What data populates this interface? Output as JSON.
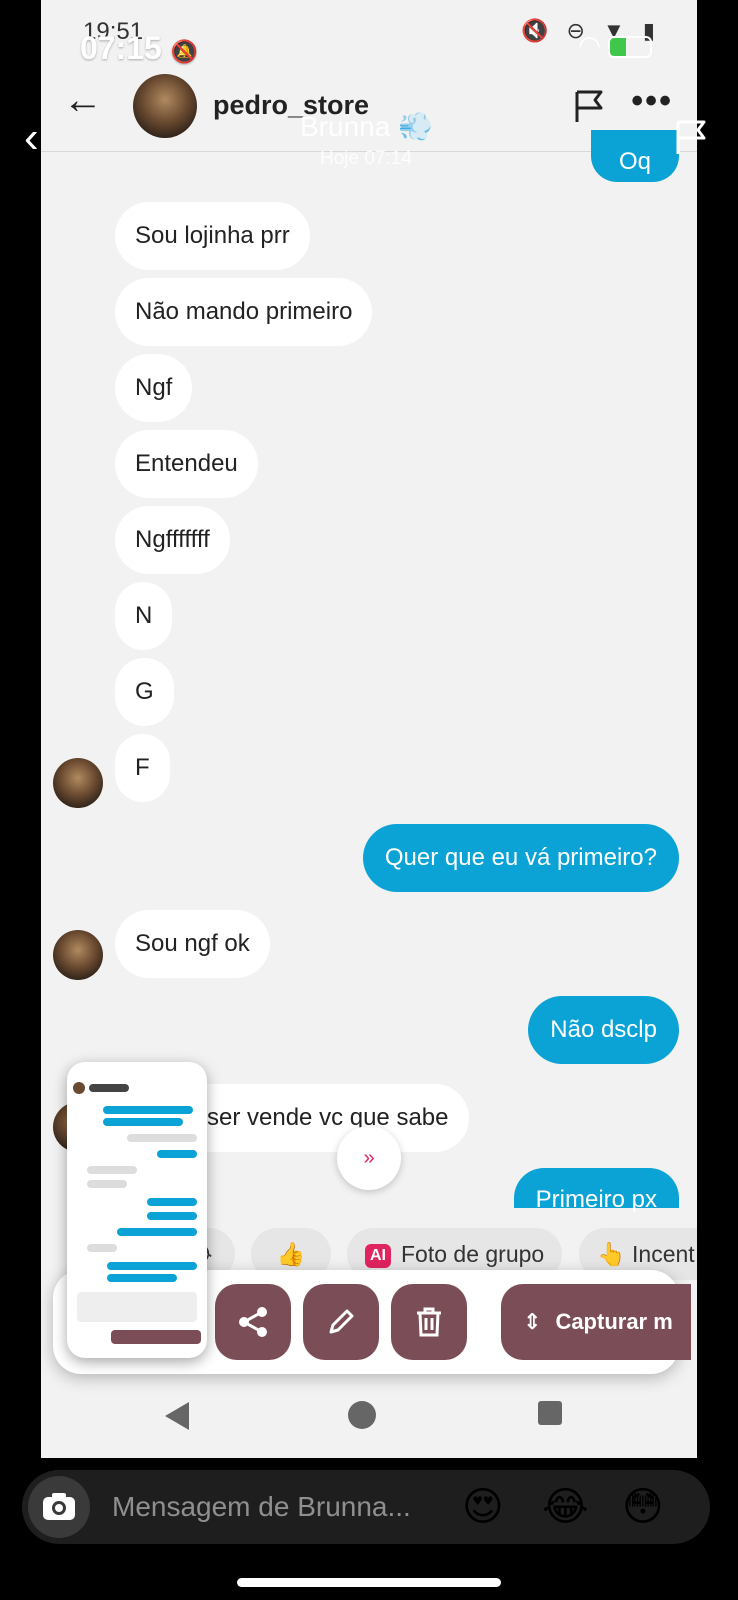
{
  "inner_status": {
    "time": "19:51",
    "icons": "🔇 ⊖ ▼ ▮"
  },
  "chat_header": {
    "username": "pedro_store"
  },
  "messages_in": [
    "Sou lojinha prr",
    "Não mando primeiro",
    "Ngf",
    "Entendeu",
    "Ngfffffff",
    "N",
    "G",
    "F",
    "Sou ngf ok",
    "ser vende vc que sabe"
  ],
  "messages_out": [
    "Oq",
    "Quer que eu vá primeiro?",
    "Não dsclp",
    "Primeiro px"
  ],
  "scroll_down_icon": "»",
  "chips": [
    "😂",
    "👍",
    "Foto de grupo",
    "Incent"
  ],
  "chip_ai_badge": "AI",
  "chip_incent_emoji": "👆",
  "toolbar": {
    "capture_label": "Capturar m"
  },
  "story": {
    "status_time": "07:15",
    "status_bell": "🔕",
    "username": "Brunna",
    "username_emoji": "💨",
    "timestamp": "Hoje 07:14",
    "reply_placeholder": "Mensagem de Brunna...",
    "reply_emojis": [
      "😍",
      "😂",
      "😳"
    ]
  },
  "colors": {
    "outgoing": "#0ba3d6",
    "toolbar": "#7b4e57",
    "ai_badge": "#e0245e"
  }
}
